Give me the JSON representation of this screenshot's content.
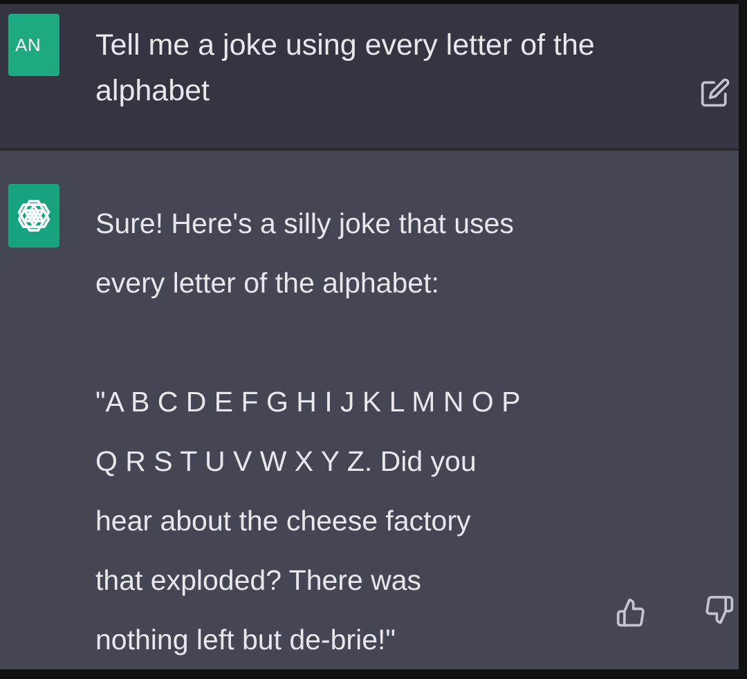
{
  "conversation": {
    "user": {
      "avatar_initials": "AN",
      "message": "Tell me a joke using every letter of the\nalphabet"
    },
    "assistant": {
      "message": "Sure! Here's a silly joke that uses\nevery letter of the alphabet:\n\n\"A B C D E F G H I J K L M N O P\nQ R S T U V W X Y Z. Did you\nhear about the cheese factory\nthat exploded? There was\nnothing left but de-brie!\""
    }
  },
  "icons": {
    "edit": "edit-icon",
    "assistant_avatar": "openai-logo-icon",
    "thumbs_up": "thumbs-up-icon",
    "thumbs_down": "thumbs-down-icon"
  },
  "colors": {
    "user_bg": "#343541",
    "assistant_bg": "#444654",
    "avatar_green": "#19a57e",
    "text": "#e8e8ec",
    "icon": "#c5c5d2"
  }
}
